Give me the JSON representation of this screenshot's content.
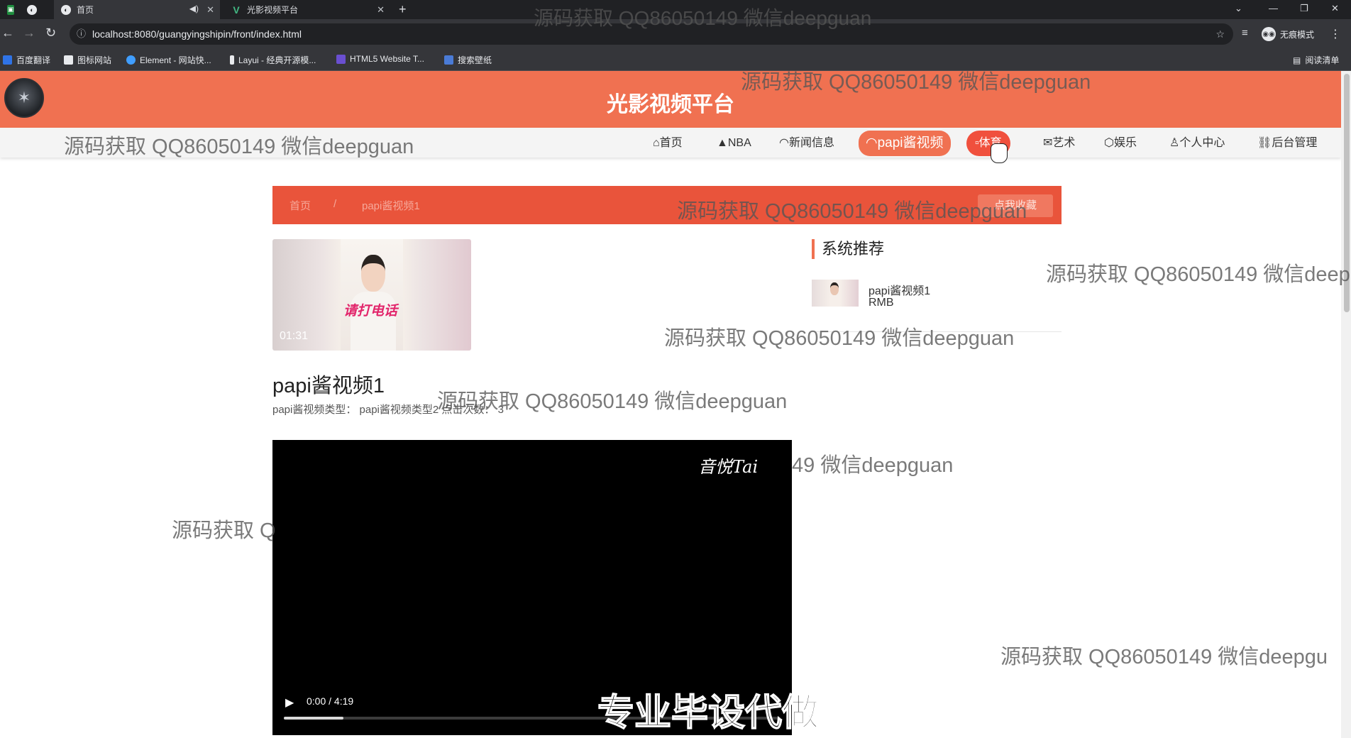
{
  "browser": {
    "tabs": [
      {
        "title": "",
        "icon": "terminal-icon"
      },
      {
        "title": "",
        "icon": "globe-icon"
      },
      {
        "title": "首页",
        "icon": "globe-icon",
        "muted_icon": "speaker-icon"
      },
      {
        "title": "光影视频平台",
        "icon": "vue-icon"
      }
    ],
    "new_tab": "+",
    "url": "localhost:8080/guangyingshipin/front/index.html",
    "incognito_label": "无痕模式",
    "reading_list": "阅读清单",
    "bookmarks": [
      {
        "label": "百度翻译",
        "color": "#2f73e6"
      },
      {
        "label": "图标网站",
        "color": "#e8eaed"
      },
      {
        "label": "Element - 网站快...",
        "color": "#409eff"
      },
      {
        "label": "Layui - 经典开源模...",
        "color": "#e8eaed"
      },
      {
        "label": "HTML5 Website T...",
        "color": "#6a4fd1"
      },
      {
        "label": "搜索壁纸",
        "color": "#4a7bd6"
      }
    ]
  },
  "site": {
    "title": "光影视频平台",
    "nav": [
      {
        "label": "首页",
        "icon": "house-icon"
      },
      {
        "label": "NBA",
        "icon": "cap-icon"
      },
      {
        "label": "新闻信息",
        "icon": "bell-icon"
      },
      {
        "label": "papi酱视频",
        "icon": "bell-icon",
        "state": "active"
      },
      {
        "label": "体育",
        "icon": "document-icon",
        "state": "hover"
      },
      {
        "label": "艺术",
        "icon": "mail-icon"
      },
      {
        "label": "娱乐",
        "icon": "cube-icon"
      },
      {
        "label": "个人中心",
        "icon": "user-icon"
      },
      {
        "label": "后台管理",
        "icon": "link-icon"
      }
    ],
    "accent_color": "#f07151"
  },
  "breadcrumb": {
    "home": "首页",
    "separator": "/",
    "current": "papi酱视频1",
    "collect_button": "点我收藏"
  },
  "video": {
    "thumbnail_caption": "请打电话",
    "duration": "01:31",
    "title": "papi酱视频1",
    "meta": "papi酱视频类型：   papi酱视频类型2   点击次数：  3",
    "player": {
      "signature": "音悦Tai",
      "time": "0:00 / 4:19",
      "progress": 0.12
    }
  },
  "recommend": {
    "title": "系统推荐",
    "items": [
      {
        "name": "papi酱视频1",
        "price": "RMB"
      }
    ]
  },
  "watermarks": {
    "text": "源码获取 QQ86050149 微信deepguan",
    "partial_1": "源码获取 QQ86050149 微信deep",
    "partial_2": "源码获取 QQ86050149 微信deepgu",
    "partial_3": "49 微信deepguan",
    "partial_4": "源码获取 Q",
    "banner": "专业毕设代做"
  }
}
